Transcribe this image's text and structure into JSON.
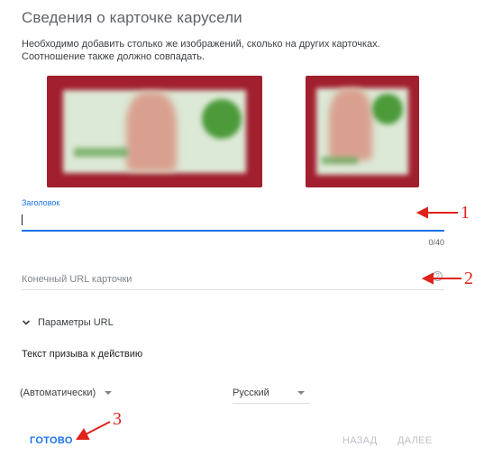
{
  "header": {
    "title": "Сведения о карточке карусели",
    "description_line1": "Необходимо добавить столько же изображений, сколько на других карточках.",
    "description_line2": "Соотношение также должно совпадать."
  },
  "headline_field": {
    "label": "Заголовок",
    "value": "",
    "counter": "0/40"
  },
  "url_field": {
    "placeholder": "Конечный URL карточки",
    "value": ""
  },
  "url_params": {
    "label": "Параметры URL"
  },
  "cta": {
    "label": "Текст призыва к действию",
    "selected": "(Автоматически)"
  },
  "language": {
    "selected": "Русский"
  },
  "buttons": {
    "done": "ГОТОВО",
    "back": "НАЗАД",
    "next": "ДАЛЕЕ"
  },
  "annotations": {
    "n1": "1",
    "n2": "2",
    "n3": "3",
    "color": "#e0231b"
  },
  "colors": {
    "accent": "#1a73e8",
    "image_frame": "#a11f2e"
  }
}
